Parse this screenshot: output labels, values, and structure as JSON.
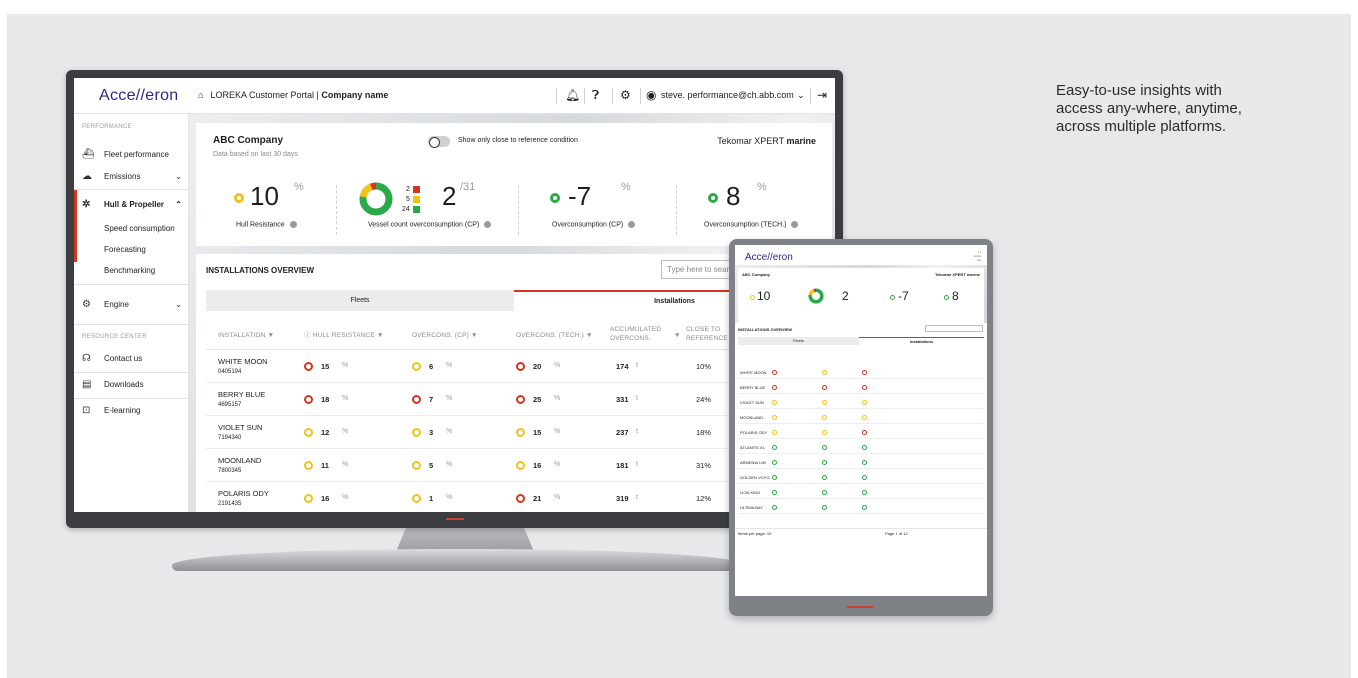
{
  "caption": "Easy-to-use insights with access any-where, anytime, across multiple platforms.",
  "colors": {
    "accent": "#d5341e",
    "yellow": "#f2c11a",
    "green": "#2aa84a",
    "red": "#d5341e"
  },
  "app": {
    "logo": "Acce//eron",
    "portal_prefix": "LOREKA Customer Portal | ",
    "portal_company": "Company name",
    "user_email": "steve. performance@ch.abb.com",
    "header_icons": [
      "bell-icon",
      "help-icon",
      "gear-icon",
      "user-icon",
      "logout-icon"
    ]
  },
  "sidebar": {
    "section_performance": "PERFORMANCE",
    "items": [
      {
        "label": "Fleet performance",
        "icon": "ship-icon"
      },
      {
        "label": "Emissions",
        "icon": "cloud-co2-icon"
      },
      {
        "label": "Hull & Propeller",
        "icon": "propeller-icon"
      },
      {
        "label": "Engine",
        "icon": "engine-icon"
      }
    ],
    "sub_items": [
      "Speed consumption",
      "Forecasting",
      "Benchmarking"
    ],
    "section_resource": "RESOURCE CENTER",
    "resource_items": [
      {
        "label": "Contact us",
        "icon": "headset-icon"
      },
      {
        "label": "Downloads",
        "icon": "download-icon"
      },
      {
        "label": "E-learning",
        "icon": "elearning-icon"
      }
    ]
  },
  "summary": {
    "company": "ABC Company",
    "based_on": "Data based on last 30 days",
    "toggle_label": "Show only close to reference condition",
    "brand_prefix": "Tekomar XPERT ",
    "brand_suffix": "marine",
    "kpis": [
      {
        "value": "10",
        "unit": "%",
        "label": "Hull Resistance",
        "status": "yellow"
      },
      {
        "value": "2",
        "unit": "/31",
        "label": "Vessel count overconsumption (CP)",
        "legend": [
          "2",
          "5",
          "24"
        ]
      },
      {
        "value": "-7",
        "unit": "%",
        "label": "Overconsumption (CP)",
        "status": "green"
      },
      {
        "value": "8",
        "unit": "%",
        "label": "Overconsumption (TECH.)",
        "status": "green"
      }
    ]
  },
  "table": {
    "title": "INSTALLATIONS OVERVIEW",
    "search_placeholder": "Type here to search",
    "tabs": [
      "Fleets",
      "Installations"
    ],
    "headers": {
      "installation": "INSTALLATION ▼",
      "hull": "ⓘ  HULL RESISTANCE ▼",
      "cp": "OVERCONS. (CP) ▼",
      "tech": "OVERCONS. (TECH.) ▼",
      "accum": "ACCUMULATED OVERCONS.",
      "close": "CLOSE TO REFERENCE"
    },
    "rows": [
      {
        "name": "WHITE MOON",
        "id": "0405194",
        "hull": "15",
        "hull_s": "red",
        "cp": "6",
        "cp_s": "yellow",
        "tech": "20",
        "tech_s": "red",
        "accum": "174",
        "close": "10%"
      },
      {
        "name": "BERRY BLUE",
        "id": "4695157",
        "hull": "18",
        "hull_s": "red",
        "cp": "7",
        "cp_s": "red",
        "tech": "25",
        "tech_s": "red",
        "accum": "331",
        "close": "24%"
      },
      {
        "name": "VIOLET SUN",
        "id": "7194340",
        "hull": "12",
        "hull_s": "yellow",
        "cp": "3",
        "cp_s": "yellow",
        "tech": "15",
        "tech_s": "yellow",
        "accum": "237",
        "close": "18%"
      },
      {
        "name": "MOONLAND",
        "id": "7800345",
        "hull": "11",
        "hull_s": "yellow",
        "cp": "5",
        "cp_s": "yellow",
        "tech": "16",
        "tech_s": "yellow",
        "accum": "181",
        "close": "31%"
      },
      {
        "name": "POLARIS ODY",
        "id": "2191435",
        "hull": "16",
        "hull_s": "yellow",
        "cp": "1",
        "cp_s": "yellow",
        "tech": "21",
        "tech_s": "red",
        "accum": "319",
        "close": "12%"
      }
    ],
    "pct": "%",
    "ton": "t"
  },
  "tablet": {
    "logo": "Acce//eron",
    "kpis": [
      "10",
      "2",
      "-7",
      "8"
    ],
    "company": "ABC Company",
    "brand": "Tekomar XPERT marine",
    "table_title": "INSTALLATIONS OVERVIEW",
    "tabs": [
      "Fleets",
      "Installations"
    ],
    "rows": [
      "WHITE MOON",
      "BERRY BLUE",
      "VIOLET SUN",
      "MOONLAND",
      "POLARIS ODY",
      "ATLANTIS XL",
      "ARMENIA LIM",
      "GOLDEN VOYG",
      "LION KING",
      "ULTIMA BAY"
    ],
    "footer_left": "Items per page: 10",
    "footer_right": "Page 1 of 12"
  }
}
